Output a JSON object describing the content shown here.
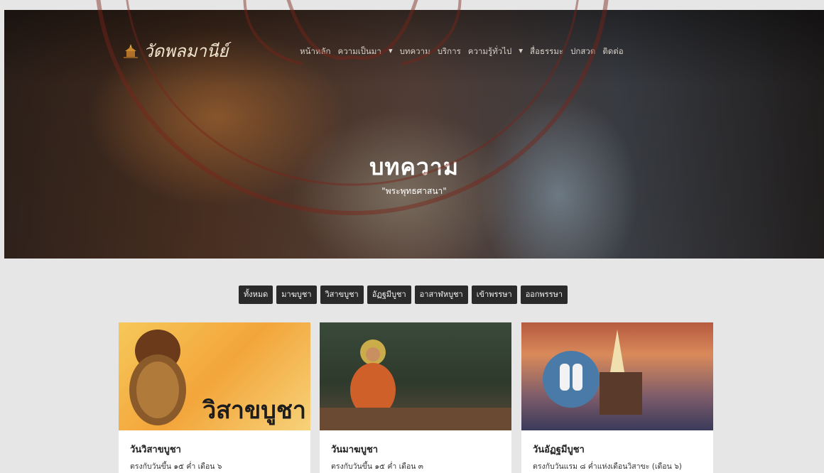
{
  "brand": {
    "name": "วัดพลมานีย์",
    "icon": "temple-icon"
  },
  "nav": {
    "items": [
      "หน้าหลัก",
      "ความเป็นมา",
      "▾",
      "บทความ",
      "บริการ",
      "ความรู้ทั่วไป",
      "▾",
      "สื่อธรรมะ",
      "ปกสวด",
      "ติดต่อ"
    ]
  },
  "hero": {
    "title": "บทความ",
    "subtitle": "\"พระพุทธศาสนา\""
  },
  "filters": [
    "ทั้งหมด",
    "มาฆบูชา",
    "วิสาขบูชา",
    "อัฏฐมีบูชา",
    "อาสาฬหบูชา",
    "เข้าพรรษา",
    "ออกพรรษา"
  ],
  "cards": [
    {
      "title": "วันวิสาขบูชา",
      "desc": "ตรงกับวันขึ้น ๑๕ ค่ำ เดือน ๖",
      "image_text": "วิสาขบูชา"
    },
    {
      "title": "วันมาฆบูชา",
      "desc": "ตรงกับวันขึ้น ๑๕ ค่ำ เดือน ๓",
      "image_text": ""
    },
    {
      "title": "วันอัฏฐมีบูชา",
      "desc": "ตรงกับวันแรม ๘ ค่ำแห่งเดือนวิสาขะ (เดือน ๖)",
      "image_text": ""
    }
  ],
  "colors": {
    "accent": "#2a2a2a",
    "seal": "#8c2a1a"
  }
}
